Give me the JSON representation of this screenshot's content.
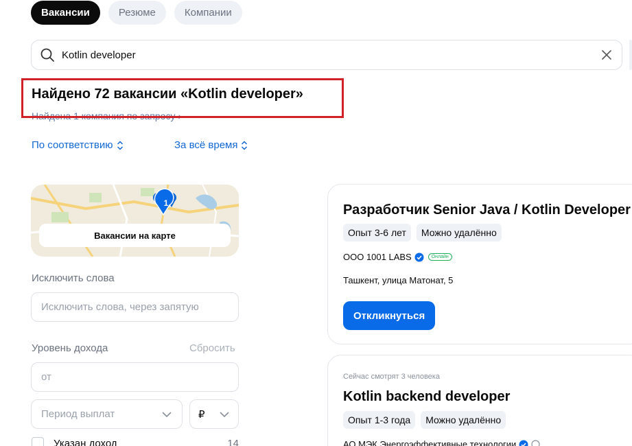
{
  "tabs": [
    {
      "label": "Вакансии",
      "active": true
    },
    {
      "label": "Резюме",
      "active": false
    },
    {
      "label": "Компании",
      "active": false
    }
  ],
  "search": {
    "value": "Kotlin developer",
    "search_icon": "search-icon",
    "clear_icon": "close-icon"
  },
  "results": {
    "title": "Найдено 72 вакансии «Kotlin developer»",
    "companies_link": "Найдена 1 компания по запросу"
  },
  "sort": {
    "relevance": "По соответствию",
    "period": "За всё время"
  },
  "map": {
    "button_label": "Вакансии на карте",
    "pin_count": "1"
  },
  "filters": {
    "exclude_label": "Исключить слова",
    "exclude_placeholder": "Исключить слова, через запятую",
    "income_label": "Уровень дохода",
    "reset_label": "Сбросить",
    "income_placeholder": "от",
    "period_placeholder": "Период выплат",
    "currency": "₽",
    "income_specified_label": "Указан доход",
    "income_specified_count": "14"
  },
  "vacancies": [
    {
      "title": "Разработчик Senior Java / Kotlin Developer",
      "chips": [
        "Опыт 3-6 лет",
        "Можно удалённо"
      ],
      "employer": "ООО 1001 LABS",
      "online_badge": "Онлайн",
      "address": "Ташкент, улица Матонат, 5",
      "apply_label": "Откликнуться"
    },
    {
      "viewers": "Сейчас смотрят 3 человека",
      "title": "Kotlin backend developer",
      "chips": [
        "Опыт 1-3 года",
        "Можно удалённо"
      ],
      "employer": "АО МЭК Энергоэффективные технологии"
    }
  ],
  "colors": {
    "accent": "#0a6be8",
    "link": "#1168d3",
    "highlight": "#d1222a",
    "online": "#1fb15b"
  }
}
